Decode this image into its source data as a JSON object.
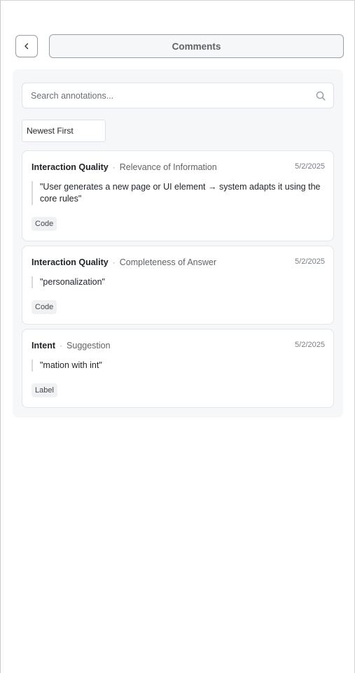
{
  "header": {
    "title": "Comments"
  },
  "search": {
    "placeholder": "Search annotations...",
    "value": ""
  },
  "sort": {
    "selected": "Newest First"
  },
  "annotations": [
    {
      "category": "Interaction Quality",
      "subcategory": "Relevance of Information",
      "date": "5/2/2025",
      "quote": "\"User generates a new page or UI element → system adapts it using the core rules\"",
      "tag": "Code"
    },
    {
      "category": "Interaction Quality",
      "subcategory": "Completeness of Answer",
      "date": "5/2/2025",
      "quote": "\"personalization\"",
      "tag": "Code"
    },
    {
      "category": "Intent",
      "subcategory": "Suggestion",
      "date": "5/2/2025",
      "quote": "\"mation with int\"",
      "tag": "Label"
    }
  ],
  "separator": "·",
  "icons": {
    "back": "chevron-left-icon",
    "search": "search-icon"
  }
}
